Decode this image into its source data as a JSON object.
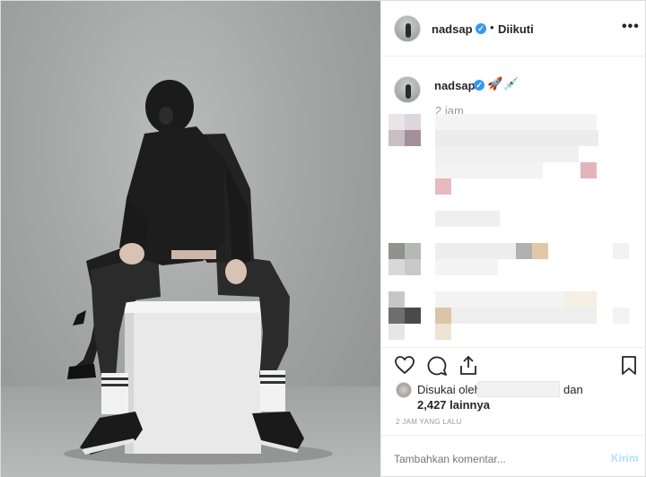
{
  "post": {
    "username": "nadsap",
    "follow_separator": "•",
    "follow_status": "Diikuti",
    "more_options": "•••",
    "verified_mark": "✓"
  },
  "caption": {
    "username": "nadsap",
    "emojis": [
      "🚀",
      "💉"
    ],
    "time": "2 jam"
  },
  "likes": {
    "liked_by_prefix": "Disukai oleh",
    "liked_by_suffix": "dan",
    "others": "2,427 lainnya"
  },
  "timestamp": "2 JAM YANG LALU",
  "comment_box": {
    "placeholder": "Tambahkan komentar...",
    "post_label": "Kirim"
  },
  "icons": {
    "like": "heart-icon",
    "comment": "comment-bubble-icon",
    "share": "share-icon",
    "save": "bookmark-icon"
  },
  "colors": {
    "verified": "#3897f0",
    "post_button_disabled": "#b2dffc",
    "muted_text": "#999999"
  }
}
